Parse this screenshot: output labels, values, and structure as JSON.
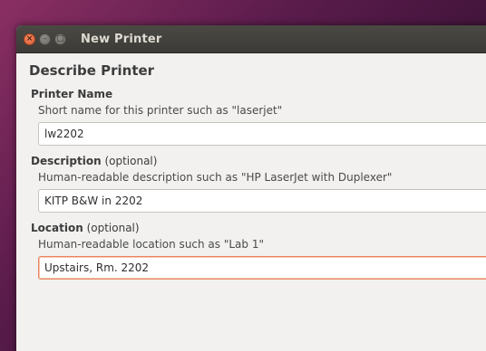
{
  "window": {
    "title": "New Printer"
  },
  "page": {
    "heading": "Describe Printer"
  },
  "printer_name": {
    "label": "Printer Name",
    "hint": "Short name for this printer such as \"laserjet\"",
    "value": "lw2202"
  },
  "description": {
    "label": "Description",
    "optional": " (optional)",
    "hint": "Human-readable description such as \"HP LaserJet with Duplexer\"",
    "value": "KITP B&W in 2202"
  },
  "location": {
    "label": "Location",
    "optional": " (optional)",
    "hint": "Human-readable location such as \"Lab 1\"",
    "value": "Upstairs, Rm. 2202"
  },
  "colors": {
    "close_button": "#dc5c2d",
    "focus_border": "#e9855d",
    "titlebar": "#3c3b37",
    "desktop": "#5b1c4c"
  },
  "icons": {
    "close": "×",
    "minimize": "–",
    "maximize": "□"
  }
}
